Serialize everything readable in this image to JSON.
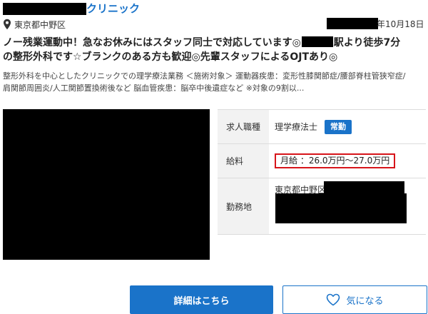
{
  "header": {
    "clinic_name": "クリニック",
    "location": "東京都中野区",
    "date": "年10月18日",
    "icons": {
      "location": "map-pin-icon",
      "favorite": "heart-icon"
    }
  },
  "headline": {
    "line1_before": "ノー残業運動中！急なお休みにはスタッフ同士で対応しています◎",
    "line1_after": "駅より徒歩7分",
    "line2": "の整形外科です☆ブランクのある方も歓迎◎先輩スタッフによるOJTあり◎"
  },
  "description": {
    "line1": "整形外科を中心としたクリニックでの理学療法業務 ＜施術対象＞ 運動器疾患：変形性膝関節症/腰部脊柱管狭窄症/",
    "line2": "肩関節周囲炎/人工関節置換術後など 脳血管疾患：脳卒中後遺症など ※対象の9割以..."
  },
  "details": {
    "job_label": "求人職種",
    "job_value": "理学療法士",
    "employment_badge": "常勤",
    "salary_label": "給料",
    "salary_value": "月給 ：26.0万円〜27.0万円",
    "work_label": "勤務地",
    "work_value": "東京都中野区"
  },
  "actions": {
    "detail_button": "詳細はこちら",
    "favorite_button": "気になる"
  },
  "colors": {
    "accent": "#1a73c9",
    "highlight_border": "#d7141a",
    "label_bg": "#f2f2f2"
  }
}
